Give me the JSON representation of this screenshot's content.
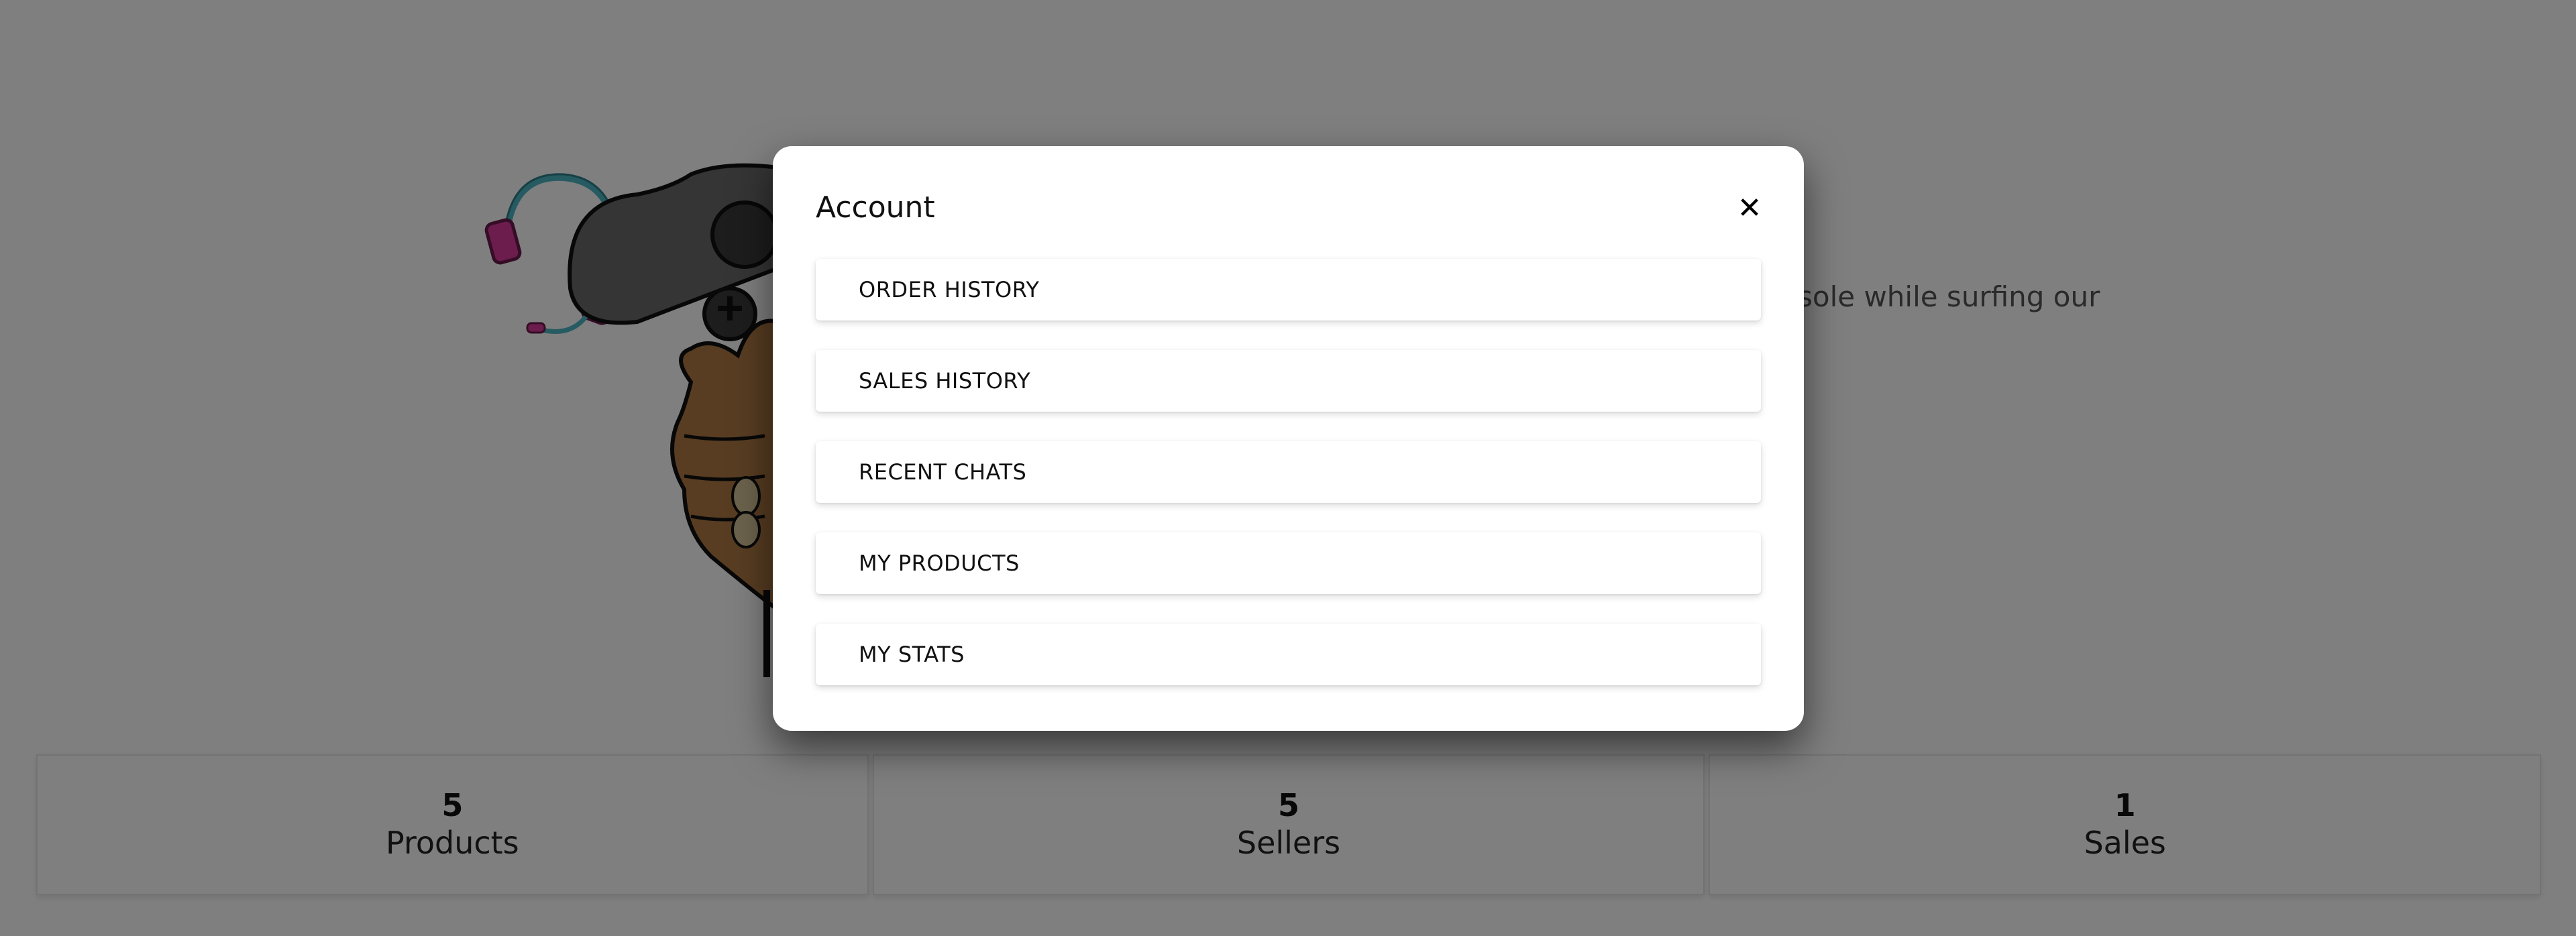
{
  "background": {
    "hero_text": "sole while surfing our",
    "stats": [
      {
        "value": "5",
        "label": "Products"
      },
      {
        "value": "5",
        "label": "Sellers"
      },
      {
        "value": "1",
        "label": "Sales"
      }
    ]
  },
  "modal": {
    "title": "Account",
    "close_icon": "close-icon",
    "items": [
      {
        "label": "ORDER HISTORY"
      },
      {
        "label": "SALES HISTORY"
      },
      {
        "label": "RECENT CHATS"
      },
      {
        "label": "MY PRODUCTS"
      },
      {
        "label": "MY STATS"
      }
    ]
  },
  "colors": {
    "overlay": "#808080",
    "modal_bg": "#ffffff",
    "headset_pink": "#d83a9a",
    "headset_teal": "#4fb6c4",
    "controller_gray": "#6b6b6b",
    "hand_brown": "#b07a44"
  }
}
